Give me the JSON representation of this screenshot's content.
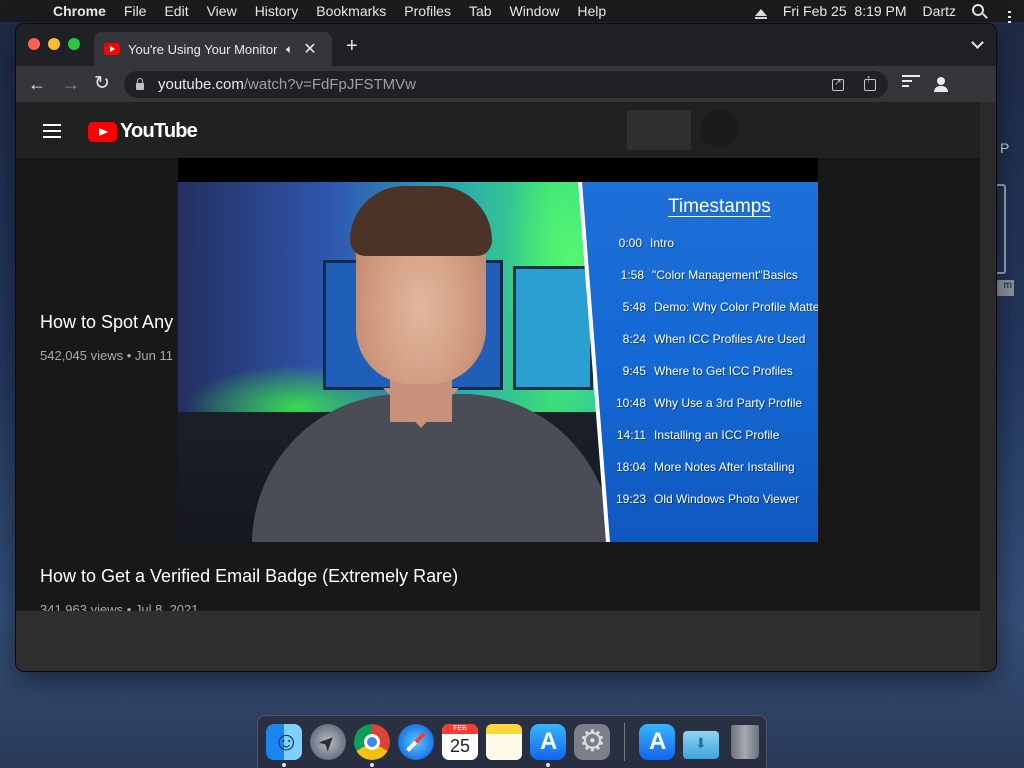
{
  "menubar": {
    "app_name": "Chrome",
    "items": [
      "File",
      "Edit",
      "View",
      "History",
      "Bookmarks",
      "Profiles",
      "Tab",
      "Window",
      "Help"
    ],
    "datetime": "Fri Feb 25  8:19 PM",
    "user": "Dartz"
  },
  "browser": {
    "tab": {
      "title": "You're Using Your Monitor",
      "close": "✕"
    },
    "new_tab": "+",
    "address": {
      "host": "youtube.com",
      "path": "/watch?v=FdFpJFSTMVw"
    }
  },
  "youtube": {
    "logo_text": "YouTube",
    "videos": [
      {
        "title": "How to Spot Any",
        "meta": "542,045 views • Jun 11"
      },
      {
        "title": "How to Get a Verified Email Badge (Extremely Rare)",
        "meta": "341,963 views • Jul 8, 2021"
      }
    ]
  },
  "video_overlay": {
    "heading": "Timestamps",
    "timestamps": [
      {
        "time": "0:00",
        "label": "Intro"
      },
      {
        "time": "1:58",
        "label": "\"Color Management\"Basics"
      },
      {
        "time": "5:48",
        "label": "Demo: Why Color Profile Matters"
      },
      {
        "time": "8:24",
        "label": "When ICC Profiles Are Used"
      },
      {
        "time": "9:45",
        "label": "Where to Get ICC Profiles"
      },
      {
        "time": "10:48",
        "label": "Why Use a 3rd Party Profile"
      },
      {
        "time": "14:11",
        "label": "Installing an ICC Profile"
      },
      {
        "time": "18:04",
        "label": "More Notes After Installing"
      },
      {
        "time": "19:23",
        "label": "Old Windows Photo Viewer"
      }
    ]
  },
  "desktop": {
    "right_glyph": "P",
    "right_chip": "m"
  },
  "dock": {
    "calendar_month": "FEB",
    "calendar_day": "25",
    "apps": [
      "finder-icon",
      "launchpad-icon",
      "chrome-icon",
      "safari-icon",
      "calendar-icon",
      "notes-icon",
      "app-store-icon",
      "system-preferences-icon",
      "app-store-icon",
      "downloads-folder-icon",
      "trash-icon"
    ]
  },
  "colors": {
    "youtube_red": "#ff0000",
    "timestamps_panel": "#1569d4",
    "page_bg": "#181818",
    "chrome_toolbar": "#35363a"
  }
}
